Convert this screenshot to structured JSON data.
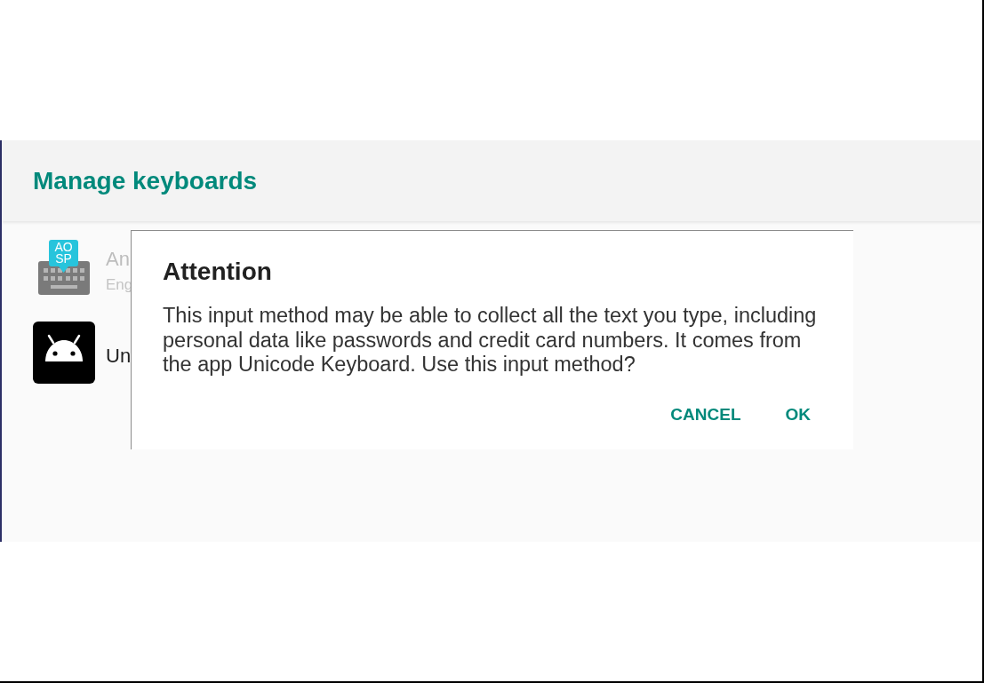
{
  "header": {
    "title": "Manage keyboards"
  },
  "keyboards": [
    {
      "kind": "keyboard",
      "badge": [
        "AO",
        "SP"
      ],
      "name": "An",
      "subtitle": "Eng",
      "disabled": true
    },
    {
      "kind": "robot",
      "name": "Un",
      "disabled": false
    }
  ],
  "dialog": {
    "title": "Attention",
    "message": "This input method may be able to collect all the text you type, including personal data like passwords and credit card numbers. It comes from the app Unicode Keyboard. Use this input method?",
    "buttons": [
      "CANCEL",
      "OK"
    ]
  }
}
